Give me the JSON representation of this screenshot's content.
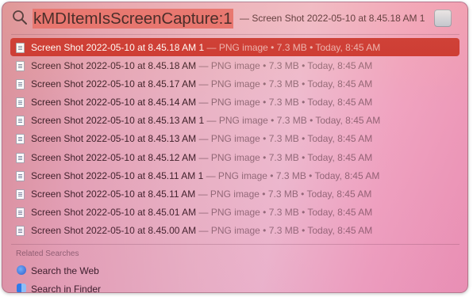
{
  "search": {
    "query": "kMDItemIsScreenCapture:1",
    "suffix": "— Screen Shot 2022-05-10 at 8.45.18 AM 1",
    "icon": "magnifying-glass-icon",
    "preview_icon": "image-preview-icon"
  },
  "results": [
    {
      "name": "Screen Shot 2022-05-10 at 8.45.18 AM 1",
      "meta": " — PNG image • 7.3 MB • Today, 8:45 AM",
      "selected": true
    },
    {
      "name": "Screen Shot 2022-05-10 at 8.45.18 AM",
      "meta": " — PNG image • 7.3 MB • Today, 8:45 AM",
      "selected": false
    },
    {
      "name": "Screen Shot 2022-05-10 at 8.45.17 AM",
      "meta": " — PNG image • 7.3 MB • Today, 8:45 AM",
      "selected": false
    },
    {
      "name": "Screen Shot 2022-05-10 at 8.45.14 AM",
      "meta": " — PNG image • 7.3 MB • Today, 8:45 AM",
      "selected": false
    },
    {
      "name": "Screen Shot 2022-05-10 at 8.45.13 AM 1",
      "meta": " — PNG image • 7.3 MB • Today, 8:45 AM",
      "selected": false
    },
    {
      "name": "Screen Shot 2022-05-10 at 8.45.13 AM",
      "meta": " — PNG image • 7.3 MB • Today, 8:45 AM",
      "selected": false
    },
    {
      "name": "Screen Shot 2022-05-10 at 8.45.12 AM",
      "meta": " — PNG image • 7.3 MB • Today, 8:45 AM",
      "selected": false
    },
    {
      "name": "Screen Shot 2022-05-10 at 8.45.11 AM 1",
      "meta": " — PNG image • 7.3 MB • Today, 8:45 AM",
      "selected": false
    },
    {
      "name": "Screen Shot 2022-05-10 at 8.45.11 AM",
      "meta": " — PNG image • 7.3 MB • Today, 8:45 AM",
      "selected": false
    },
    {
      "name": "Screen Shot 2022-05-10 at 8.45.01 AM",
      "meta": " — PNG image • 7.3 MB • Today, 8:45 AM",
      "selected": false
    },
    {
      "name": "Screen Shot 2022-05-10 at 8.45.00 AM",
      "meta": " — PNG image • 7.3 MB • Today, 8:45 AM",
      "selected": false
    }
  ],
  "related_title": "Related Searches",
  "related": [
    {
      "label": "Search the Web",
      "icon": "web-search-icon"
    },
    {
      "label": "Search in Finder",
      "icon": "finder-icon"
    }
  ],
  "colors": {
    "selection": "#c9312c",
    "query_highlight": "#e46a6a"
  }
}
